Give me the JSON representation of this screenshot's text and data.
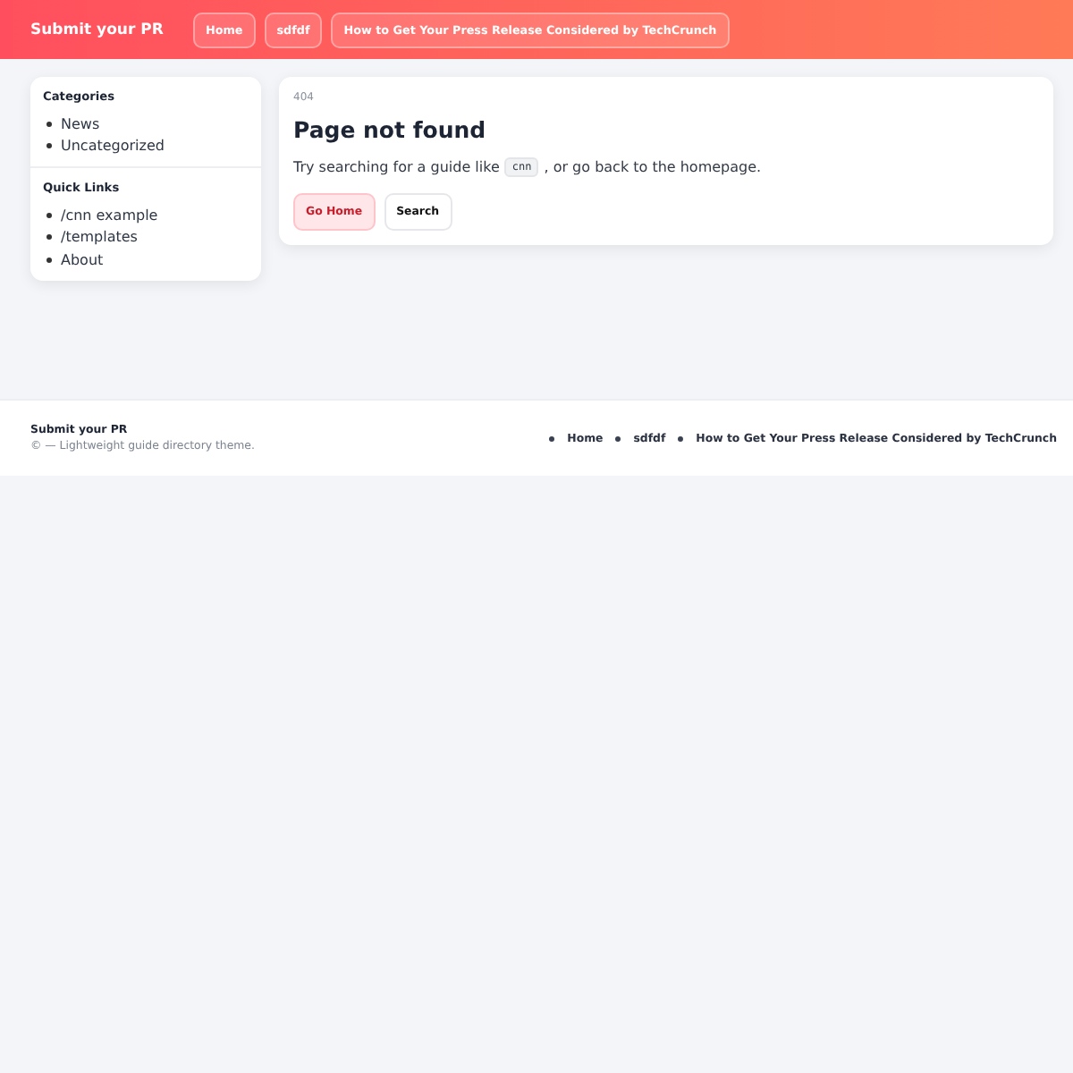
{
  "header": {
    "brand": "Submit your PR",
    "nav": [
      {
        "label": "Home"
      },
      {
        "label": "sdfdf"
      },
      {
        "label": "How to Get Your Press Release Considered by TechCrunch"
      }
    ]
  },
  "sidebar": {
    "sections": [
      {
        "title": "Categories",
        "items": [
          "News",
          "Uncategorized"
        ]
      },
      {
        "title": "Quick Links",
        "items": [
          "/cnn example",
          "/templates",
          "About"
        ]
      }
    ]
  },
  "main": {
    "code": "404",
    "title": "Page not found",
    "message_before": "Try searching for a guide like",
    "message_code": "cnn",
    "message_after": ", or go back to the homepage.",
    "buttons": [
      {
        "label": "Go Home",
        "kind": "primary"
      },
      {
        "label": "Search",
        "kind": "secondary"
      }
    ]
  },
  "footer": {
    "brand": "Submit your PR",
    "tagline": "© — Lightweight guide directory theme.",
    "links": [
      "Home",
      "sdfdf",
      "How to Get Your Press Release Considered by TechCrunch"
    ]
  }
}
